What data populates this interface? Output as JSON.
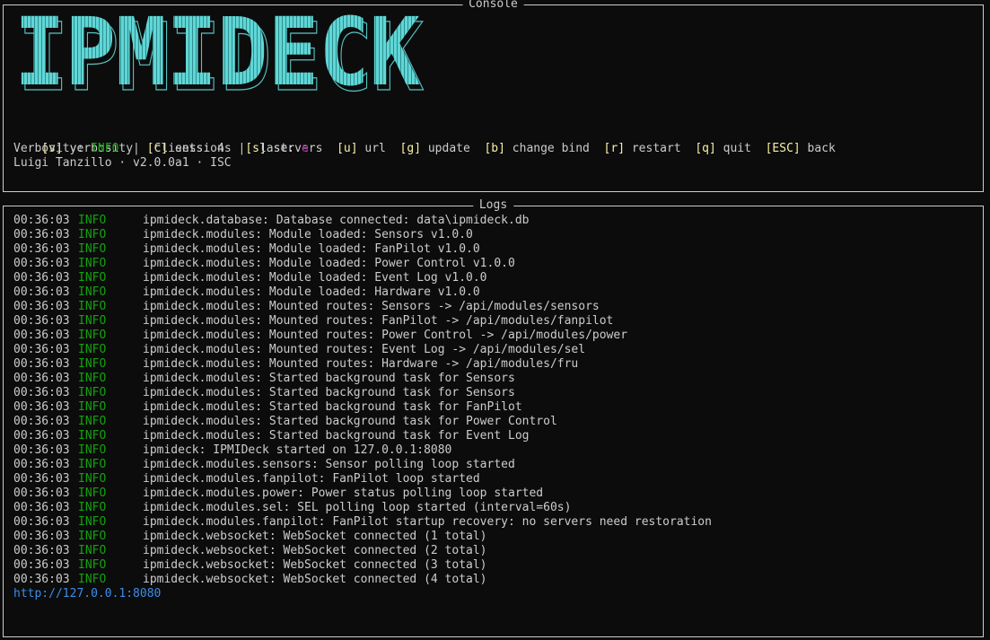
{
  "console": {
    "title": "Console",
    "logo_text": "IPMIDECK",
    "keys": [
      {
        "key": "[v]",
        "label": " verbosity"
      },
      {
        "key": "[c]",
        "label": " sessions"
      },
      {
        "key": "[s]",
        "label": " servers"
      },
      {
        "key": "[u]",
        "label": " url"
      },
      {
        "key": "[g]",
        "label": " update"
      },
      {
        "key": "[b]",
        "label": " change bind"
      },
      {
        "key": "[r]",
        "label": " restart"
      },
      {
        "key": "[q]",
        "label": " quit"
      },
      {
        "key": "[ESC]",
        "label": " back"
      }
    ],
    "status": {
      "verbosity_label": "Verbosity: ",
      "verbosity_value": "INFO",
      "sep1": "  |  ",
      "clients_label": "Clients: ",
      "clients_value": "4",
      "sep2": "  |  ",
      "last_label": "last: ",
      "last_value": "u"
    },
    "author_line": "Luigi Tanzillo · v2.0.0a1 · ISC"
  },
  "logs": {
    "title": "Logs",
    "entries": [
      {
        "time": "00:36:03",
        "level": "INFO",
        "msg": "ipmideck.database: Database connected: data\\ipmideck.db"
      },
      {
        "time": "00:36:03",
        "level": "INFO",
        "msg": "ipmideck.modules: Module loaded: Sensors v1.0.0"
      },
      {
        "time": "00:36:03",
        "level": "INFO",
        "msg": "ipmideck.modules: Module loaded: FanPilot v1.0.0"
      },
      {
        "time": "00:36:03",
        "level": "INFO",
        "msg": "ipmideck.modules: Module loaded: Power Control v1.0.0"
      },
      {
        "time": "00:36:03",
        "level": "INFO",
        "msg": "ipmideck.modules: Module loaded: Event Log v1.0.0"
      },
      {
        "time": "00:36:03",
        "level": "INFO",
        "msg": "ipmideck.modules: Module loaded: Hardware v1.0.0"
      },
      {
        "time": "00:36:03",
        "level": "INFO",
        "msg": "ipmideck.modules: Mounted routes: Sensors -> /api/modules/sensors"
      },
      {
        "time": "00:36:03",
        "level": "INFO",
        "msg": "ipmideck.modules: Mounted routes: FanPilot -> /api/modules/fanpilot"
      },
      {
        "time": "00:36:03",
        "level": "INFO",
        "msg": "ipmideck.modules: Mounted routes: Power Control -> /api/modules/power"
      },
      {
        "time": "00:36:03",
        "level": "INFO",
        "msg": "ipmideck.modules: Mounted routes: Event Log -> /api/modules/sel"
      },
      {
        "time": "00:36:03",
        "level": "INFO",
        "msg": "ipmideck.modules: Mounted routes: Hardware -> /api/modules/fru"
      },
      {
        "time": "00:36:03",
        "level": "INFO",
        "msg": "ipmideck.modules: Started background task for Sensors"
      },
      {
        "time": "00:36:03",
        "level": "INFO",
        "msg": "ipmideck.modules: Started background task for Sensors"
      },
      {
        "time": "00:36:03",
        "level": "INFO",
        "msg": "ipmideck.modules: Started background task for FanPilot"
      },
      {
        "time": "00:36:03",
        "level": "INFO",
        "msg": "ipmideck.modules: Started background task for Power Control"
      },
      {
        "time": "00:36:03",
        "level": "INFO",
        "msg": "ipmideck.modules: Started background task for Event Log"
      },
      {
        "time": "00:36:03",
        "level": "INFO",
        "msg": "ipmideck: IPMIDeck started on 127.0.0.1:8080"
      },
      {
        "time": "00:36:03",
        "level": "INFO",
        "msg": "ipmideck.modules.sensors: Sensor polling loop started"
      },
      {
        "time": "00:36:03",
        "level": "INFO",
        "msg": "ipmideck.modules.fanpilot: FanPilot loop started"
      },
      {
        "time": "00:36:03",
        "level": "INFO",
        "msg": "ipmideck.modules.power: Power status polling loop started"
      },
      {
        "time": "00:36:03",
        "level": "INFO",
        "msg": "ipmideck.modules.sel: SEL polling loop started (interval=60s)"
      },
      {
        "time": "00:36:03",
        "level": "INFO",
        "msg": "ipmideck.modules.fanpilot: FanPilot startup recovery: no servers need restoration"
      },
      {
        "time": "00:36:03",
        "level": "INFO",
        "msg": "ipmideck.websocket: WebSocket connected (1 total)"
      },
      {
        "time": "00:36:03",
        "level": "INFO",
        "msg": "ipmideck.websocket: WebSocket connected (2 total)"
      },
      {
        "time": "00:36:03",
        "level": "INFO",
        "msg": "ipmideck.websocket: WebSocket connected (3 total)"
      },
      {
        "time": "00:36:03",
        "level": "INFO",
        "msg": "ipmideck.websocket: WebSocket connected (4 total)"
      }
    ],
    "url": "http://127.0.0.1:8080"
  },
  "colors": {
    "background": "#0c0c0c",
    "text": "#cccccc",
    "logo_fill": "#61d6d6",
    "key_yellow": "#f9f1a5",
    "info_green": "#13a10e",
    "last_magenta": "#b4009e",
    "url_blue": "#3b8eea"
  }
}
